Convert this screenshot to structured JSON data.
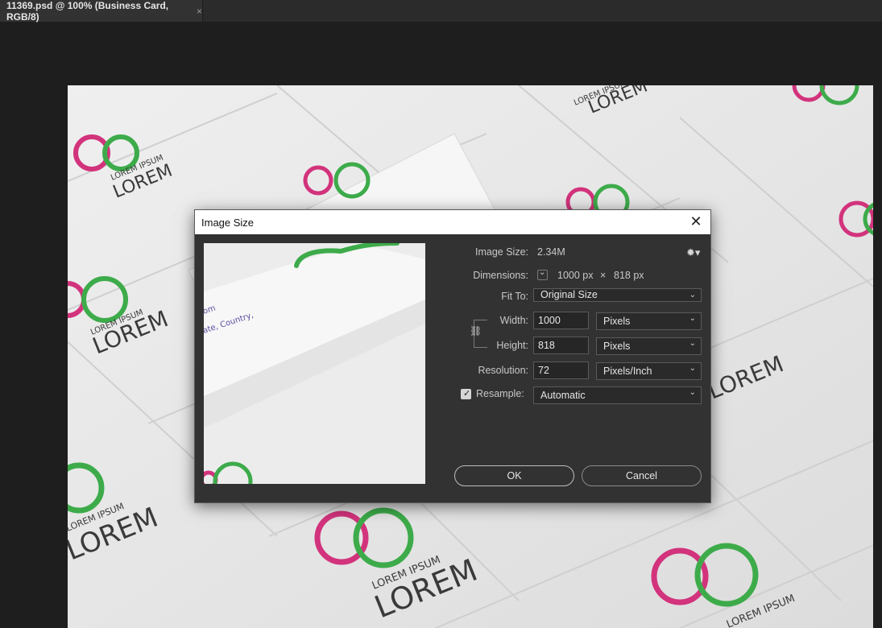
{
  "document_tab": {
    "title": "11369.psd @ 100% (Business Card, RGB/8)",
    "close": "×"
  },
  "canvas": {
    "card_text_top": "LOREM IPSUM",
    "card_text_big": "LOREM",
    "preview_text_1": "om",
    "preview_text_2": "ate, Country,",
    "colors": {
      "paper": "#e9e9e9",
      "ring_pink": "#d2337c",
      "ring_green": "#3dab4a",
      "ink": "#3a3a3a"
    }
  },
  "dialog": {
    "title": "Image Size",
    "close_icon": "close-icon",
    "image_size_label": "Image Size:",
    "image_size_value": "2.34M",
    "dimensions_label": "Dimensions:",
    "dimensions_width": "1000 px",
    "dimensions_times": "×",
    "dimensions_height": "818 px",
    "fit_to_label": "Fit To:",
    "fit_to_value": "Original Size",
    "width_label": "Width:",
    "width_value": "1000",
    "width_unit": "Pixels",
    "height_label": "Height:",
    "height_value": "818",
    "height_unit": "Pixels",
    "resolution_label": "Resolution:",
    "resolution_value": "72",
    "resolution_unit": "Pixels/Inch",
    "resample_label": "Resample:",
    "resample_checked": true,
    "resample_value": "Automatic",
    "ok_label": "OK",
    "cancel_label": "Cancel"
  }
}
